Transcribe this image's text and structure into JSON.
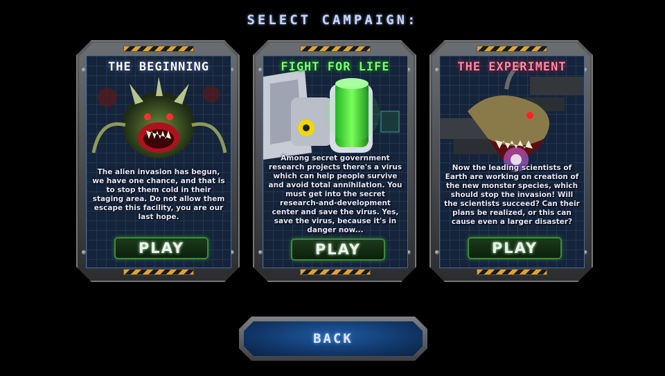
{
  "screen_title": "SELECT CAMPAIGN:",
  "campaigns": [
    {
      "title": "THE BEGINNING",
      "title_color": "#ffffff",
      "description": "The alien invasion has begun, we have one chance, and that is to stop them cold in their staging area. Do not allow them escape this facility, you are our last hope.",
      "play_label": "PLAY"
    },
    {
      "title": "FIGHT FOR LIFE",
      "title_color": "#7dff7d",
      "description": "Among secret government research projects there's a virus which can help people survive and avoid total annihilation. You must get into the secret research-and-development center and save the virus. Yes, save the virus, because it's in danger now...",
      "play_label": "PLAY"
    },
    {
      "title": "THE EXPERIMENT",
      "title_color": "#ff8aa8",
      "description": "Now the leading scientists of Earth are working on creation of the new monster species, which should stop the invasion! Will the scientists succeed? Can their plans be realized, or this can cause even a larger disaster?",
      "play_label": "PLAY"
    }
  ],
  "back_label": "BACK",
  "colors": {
    "play_border": "#3c8a3c",
    "back_fill": "#1f5aa0",
    "hazard_yellow": "#e2a42a"
  }
}
